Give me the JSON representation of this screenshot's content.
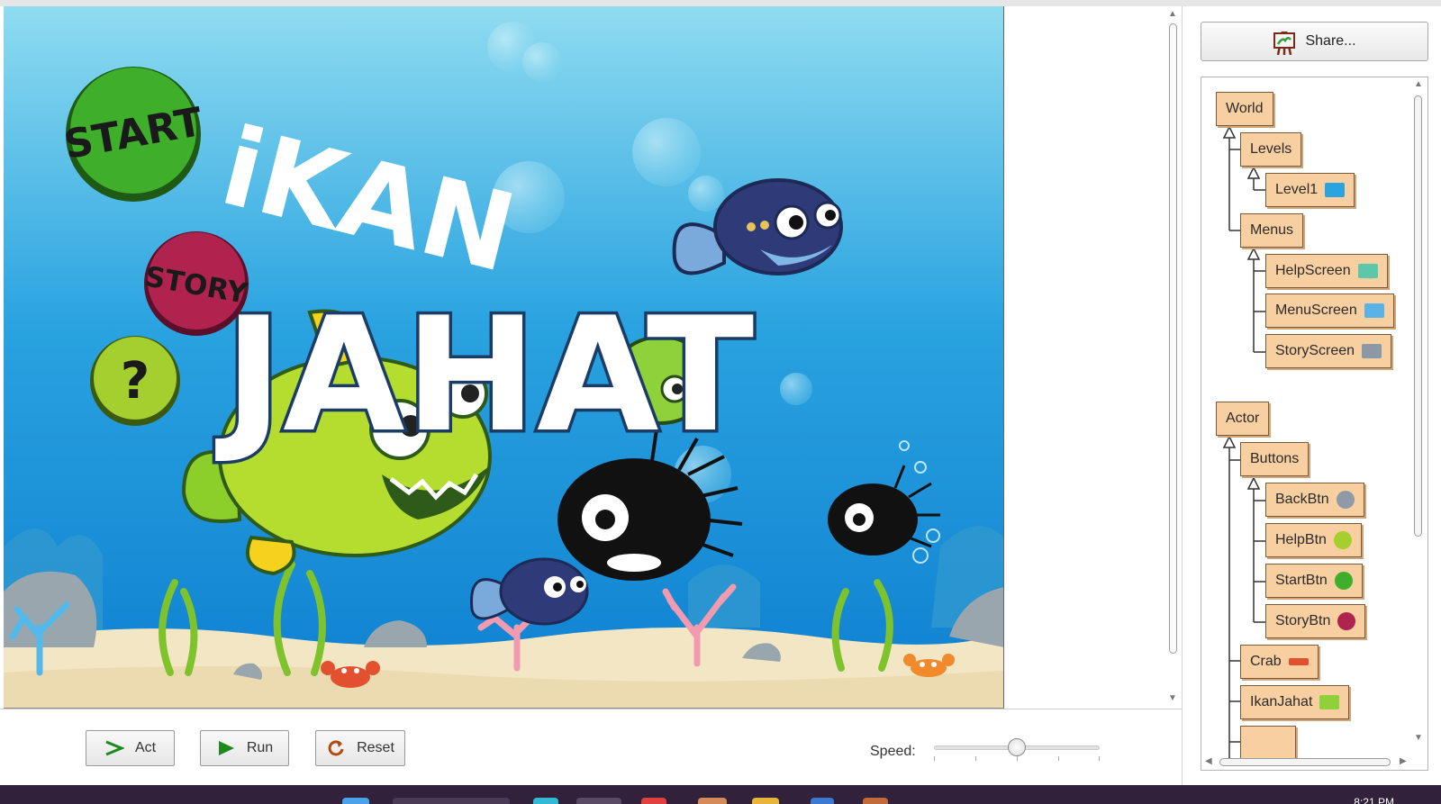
{
  "world": {
    "title_top": "iKAN",
    "title_bottom": "JAHAT",
    "buttons": {
      "start": "START",
      "story": "STORY",
      "help": "?"
    },
    "colors": {
      "water_top": "#8fdcf0",
      "water_bottom": "#0e7fd0",
      "sand": "#f3e6c4",
      "start": "#3fae2a",
      "story": "#b0234f",
      "help": "#a4cf2f"
    }
  },
  "controls": {
    "act_label": "Act",
    "run_label": "Run",
    "reset_label": "Reset",
    "speed_label": "Speed:",
    "speed_value": 0.5
  },
  "panel": {
    "share_label": "Share...",
    "tree": {
      "world_root": "World",
      "levels": "Levels",
      "level1": "Level1",
      "menus": "Menus",
      "help_screen": "HelpScreen",
      "menu_screen": "MenuScreen",
      "story_screen": "StoryScreen",
      "actor_root": "Actor",
      "buttons": "Buttons",
      "back_btn": "BackBtn",
      "help_btn": "HelpBtn",
      "start_btn": "StartBtn",
      "story_btn": "StoryBtn",
      "crab": "Crab",
      "ikan_jahat": "IkanJahat"
    }
  },
  "taskbar": {
    "clock": "8:21 PM"
  }
}
